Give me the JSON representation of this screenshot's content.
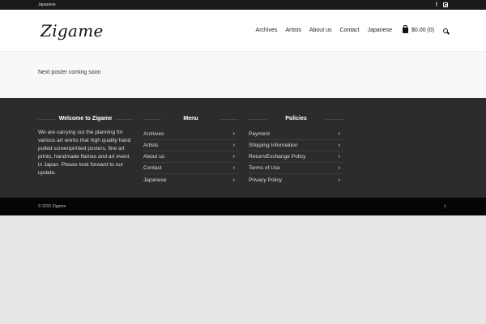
{
  "topbar": {
    "language_link": "Japanese",
    "social": [
      "facebook-icon",
      "instagram-icon"
    ]
  },
  "header": {
    "logo": "Zigame",
    "nav": [
      "Archives",
      "Artists",
      "About us",
      "Contact",
      "Japanese"
    ],
    "cart_label": "$0.00 (0)"
  },
  "main": {
    "message": "Next poster coming soon"
  },
  "footer": {
    "welcome_title": "Welcome to Zigame",
    "welcome_text": "We are carrying out the planning for various art works that high quality hand pulled screenprinted posters, fine art prints, handmade flames and art event in Japan. Please look forward to our update.",
    "menu_title": "Menu",
    "menu_items": [
      "Archives",
      "Artists",
      "About us",
      "Contact",
      "Japanese"
    ],
    "policies_title": "Policies",
    "policy_items": [
      "Payment",
      "Shipping Information",
      "Return/Exchange Policy",
      "Terms of Use",
      "Privacy Policy"
    ]
  },
  "bottom": {
    "copyright": "© 2015 Zigame"
  },
  "colors": {
    "topbar": "#1a1a1a",
    "footer": "#2c2c2c",
    "bottombar": "#050505",
    "page_bg": "#e5e5e5"
  }
}
